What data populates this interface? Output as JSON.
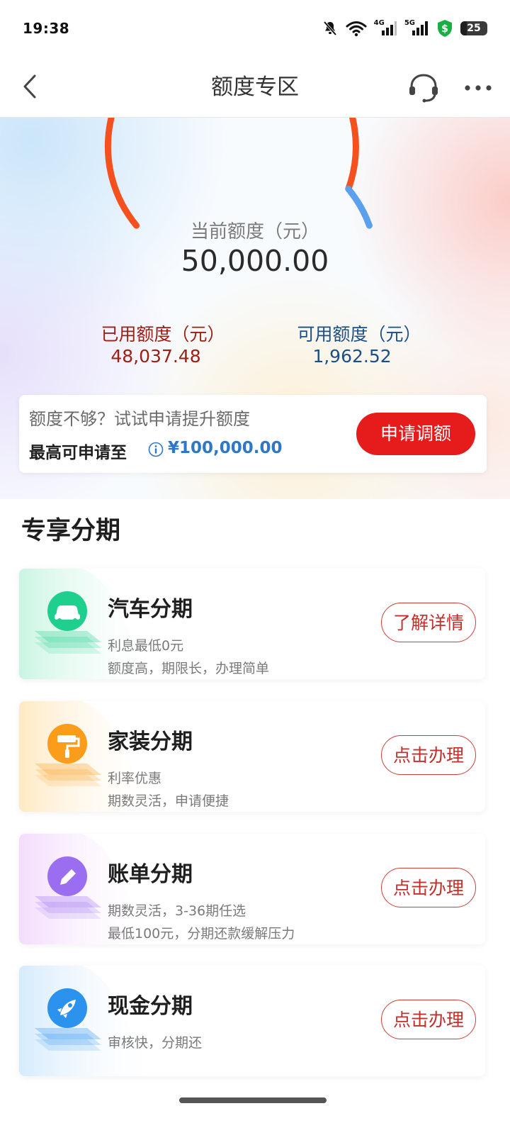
{
  "status_bar": {
    "time": "19:38",
    "icons": [
      "mute-icon",
      "wifi-icon",
      "signal-4g-icon",
      "signal-5g-icon",
      "security-shield-icon",
      "battery-icon"
    ],
    "net_4g": "4G",
    "net_5g": "5G",
    "battery": "25"
  },
  "nav": {
    "title": "额度专区",
    "icons": [
      "back-arrow-icon",
      "headset-icon",
      "more-icon"
    ]
  },
  "quota": {
    "current_label": "当前额度（元）",
    "current_value": "50,000.00",
    "used_label": "已用额度（元）",
    "used_value": "48,037.48",
    "available_label": "可用额度（元）",
    "available_value": "1,962.52",
    "used_fraction": 0.9608,
    "colors": {
      "used": "#f4511e",
      "available": "#5aa0ec"
    }
  },
  "limit_card": {
    "hint": "额度不够？试试申请提升额度",
    "max_label": "最高可申请至",
    "max_value": "¥100,000.00",
    "button": "申请调额"
  },
  "section_title": "专享分期",
  "cards": [
    {
      "title": "汽车分期",
      "line1": "利息最低0元",
      "line2": "额度高，期限长，办理简单",
      "button": "了解详情",
      "icon": "car-icon",
      "color": "#1fcf8e"
    },
    {
      "title": "家装分期",
      "line1": "利率优惠",
      "line2": "期数灵活，申请便捷",
      "button": "点击办理",
      "icon": "paint-roller-icon",
      "color": "#fb9c1a"
    },
    {
      "title": "账单分期",
      "line1": "期数灵活，3-36期任选",
      "line2": "最低100元，分期还款缓解压力",
      "button": "点击办理",
      "icon": "pencil-icon",
      "color": "#9b6df0"
    },
    {
      "title": "现金分期",
      "line1": "审核快，分期还",
      "line2": "",
      "button": "点击办理",
      "icon": "rocket-icon",
      "color": "#2b93ee"
    }
  ]
}
